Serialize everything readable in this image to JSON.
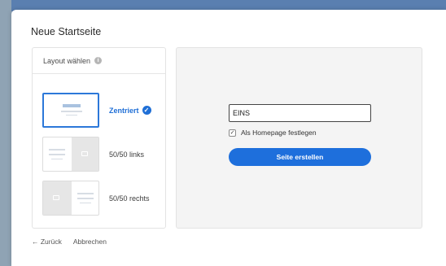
{
  "dialog": {
    "title": "Neue Startseite"
  },
  "layout": {
    "header": "Layout wählen",
    "options": [
      {
        "label": "Zentriert",
        "selected": true
      },
      {
        "label": "50/50 links",
        "selected": false
      },
      {
        "label": "50/50 rechts",
        "selected": false
      }
    ]
  },
  "form": {
    "name_value": "EINS",
    "homepage_label": "Als Homepage festlegen",
    "homepage_checked": true,
    "create_label": "Seite erstellen"
  },
  "footer": {
    "back_label": "← Zurück",
    "cancel_label": "Abbrechen"
  },
  "colors": {
    "accent": "#1e6fdc"
  }
}
